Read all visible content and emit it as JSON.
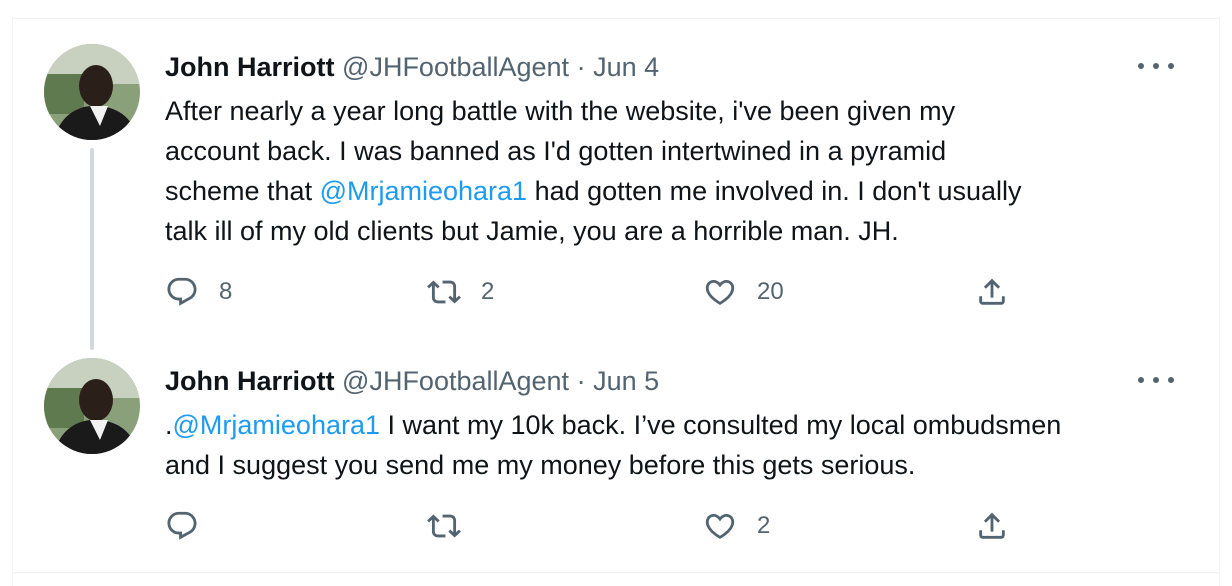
{
  "tweets": [
    {
      "author_name": "John Harriott",
      "handle": "@JHFootballAgent",
      "separator": "·",
      "date": "Jun 4",
      "text_lines": [
        [
          {
            "t": "After nearly a year long battle with the website, i've been given my"
          }
        ],
        [
          {
            "t": "account back. I was banned as I'd gotten intertwined in a pyramid"
          }
        ],
        [
          {
            "t": "scheme that "
          },
          {
            "t": "@Mrjamieohara1",
            "mention": true
          },
          {
            "t": " had gotten me involved in. I don't usually"
          }
        ],
        [
          {
            "t": "talk ill of my old clients but Jamie, you are a horrible man. JH."
          }
        ]
      ],
      "replies": "8",
      "retweets": "2",
      "likes": "20"
    },
    {
      "author_name": "John Harriott",
      "handle": "@JHFootballAgent",
      "separator": "·",
      "date": "Jun 5",
      "text_lines": [
        [
          {
            "t": "."
          },
          {
            "t": "@Mrjamieohara1",
            "mention": true
          },
          {
            "t": " I want my 10k back. I’ve consulted my local ombudsmen"
          }
        ],
        [
          {
            "t": "and I suggest you send me my money before this gets serious."
          }
        ]
      ],
      "replies": "",
      "retweets": "",
      "likes": "2"
    }
  ],
  "icons": {
    "reply": "reply-icon",
    "retweet": "retweet-icon",
    "like": "heart-icon",
    "share": "share-icon",
    "more": "more-icon"
  },
  "colors": {
    "text": "#0f1419",
    "secondary": "#536471",
    "mention": "#1d9bf0",
    "thread_line": "#cfd9de"
  }
}
